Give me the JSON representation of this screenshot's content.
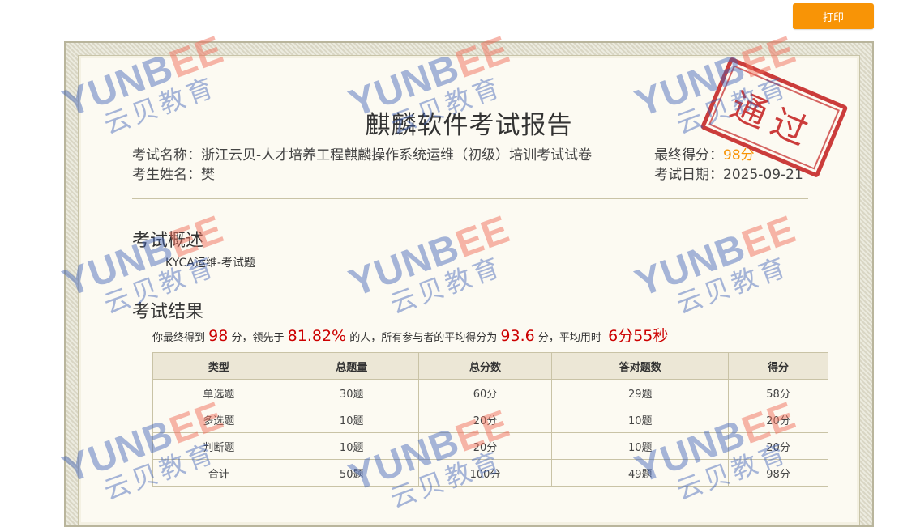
{
  "toolbar": {
    "print_label": "打印"
  },
  "report": {
    "title": "麒麟软件考试报告",
    "exam_name_label": "考试名称：",
    "exam_name": "浙江云贝-人才培养工程麒麟操作系统运维（初级）培训考试试卷",
    "student_label": "考生姓名：",
    "student_name": "樊",
    "score_label": "最终得分：",
    "score": "98分",
    "date_label": "考试日期：",
    "date": "2025-09-21"
  },
  "stamp": {
    "text": "通过",
    "color": "#c62828"
  },
  "overview": {
    "title": "考试概述",
    "text": "KYCA运维-考试题"
  },
  "results": {
    "title": "考试结果",
    "summary": {
      "p1": "你最终得到",
      "score": "98",
      "p2": "分，领先于",
      "percent": "81.82%",
      "p3": "的人，所有参与者的平均得分为",
      "avg": "93.6",
      "p4": "分，平均用时",
      "time": "6分55秒"
    },
    "columns": [
      "类型",
      "总题量",
      "总分数",
      "答对题数",
      "得分"
    ],
    "rows": [
      [
        "单选题",
        "30题",
        "60分",
        "29题",
        "58分"
      ],
      [
        "多选题",
        "10题",
        "20分",
        "10题",
        "20分"
      ],
      [
        "判断题",
        "10题",
        "20分",
        "10题",
        "20分"
      ],
      [
        "合计",
        "50题",
        "100分",
        "49题",
        "98分"
      ]
    ]
  },
  "watermark": {
    "en_a": "YUNB",
    "en_b": "EE",
    "cn": "云贝教育"
  },
  "colors": {
    "accent_orange": "#f89406",
    "highlight_red": "#cc0000",
    "watermark_blue": "#3b60b6"
  }
}
